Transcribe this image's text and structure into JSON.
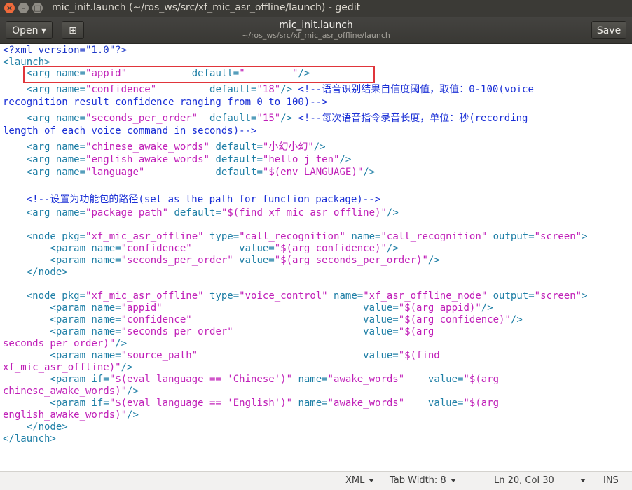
{
  "window": {
    "title": "mic_init.launch (~/ros_ws/src/xf_mic_asr_offline/launch) - gedit",
    "close": "×",
    "minimize": "–",
    "maximize": "□"
  },
  "toolbar": {
    "open_label": "Open ▾",
    "save_label": "Save",
    "doc_title": "mic_init.launch",
    "doc_path": "~/ros_ws/src/xf_mic_asr_offline/launch",
    "new_tab_icon": "⊞"
  },
  "code": {
    "l1": "<?xml version=\"1.0\"?>",
    "l2": "<launch>",
    "l3a": "    <arg name=",
    "l3b": "\"appid\"",
    "l3c": "           default=",
    "l3d": "\"        \"",
    "l3e": "/>",
    "l4a": "    <arg name=",
    "l4b": "\"confidence\"",
    "l4c": "         default=",
    "l4d": "\"18\"",
    "l4e": "/> ",
    "l4f": "<!--语音识别结果自信度阈值，取值：0-100(voice",
    "l5": "recognition result confidence ranging from 0 to 100)-->",
    "l6a": "    <arg name=",
    "l6b": "\"seconds_per_order\"",
    "l6c": "  default=",
    "l6d": "\"15\"",
    "l6e": "/> ",
    "l6f": "<!--每次语音指令录音长度，单位：秒(recording",
    "l7": "length of each voice command in seconds)-->",
    "l8a": "    <arg name=",
    "l8b": "\"chinese_awake_words\"",
    "l8c": " default=",
    "l8d": "\"小幻小幻\"",
    "l8e": "/>",
    "l9a": "    <arg name=",
    "l9b": "\"english_awake_words\"",
    "l9c": " default=",
    "l9d": "\"hello j ten\"",
    "l9e": "/>",
    "l10a": "    <arg name=",
    "l10b": "\"language\"",
    "l10c": "            default=",
    "l10d": "\"$(env LANGUAGE)\"",
    "l10e": "/>",
    "l12": "    <!--设置为功能包的路径(set as the path for function package)-->",
    "l13a": "    <arg name=",
    "l13b": "\"package_path\"",
    "l13c": " default=",
    "l13d": "\"$(find xf_mic_asr_offline)\"",
    "l13e": "/>",
    "l15a": "    <node pkg=",
    "l15b": "\"xf_mic_asr_offline\"",
    "l15c": " type=",
    "l15d": "\"call_recognition\"",
    "l15e": " name=",
    "l15f": "\"call_recognition\"",
    "l15g": " output=",
    "l15h": "\"screen\"",
    "l15i": ">",
    "l16a": "        <param name=",
    "l16b": "\"confidence\"",
    "l16c": "        value=",
    "l16d": "\"$(arg confidence)\"",
    "l16e": "/>",
    "l17a": "        <param name=",
    "l17b": "\"seconds_per_order\"",
    "l17c": " value=",
    "l17d": "\"$(arg seconds_per_order)\"",
    "l17e": "/>",
    "l18": "    </node>",
    "l20a": "    <node pkg=",
    "l20b": "\"xf_mic_asr_offline\"",
    "l20c": " type=",
    "l20d": "\"voice_control\"",
    "l20e": " name=",
    "l20f": "\"xf_asr_offline_node\"",
    "l20g": " output=",
    "l20h": "\"screen\"",
    "l20i": ">",
    "l21a": "        <param name=",
    "l21b": "\"appid\"",
    "l21c": "                                  value=",
    "l21d": "\"$(arg appid)\"",
    "l21e": "/>",
    "l22a": "        <param name=",
    "l22b": "\"confidence\"",
    "l22c": "                             value=",
    "l22d": "\"$(arg confidence)\"",
    "l22e": "/>",
    "l23a": "        <param name=",
    "l23b": "\"seconds_per_order\"",
    "l23c": "                      value=",
    "l23d": "\"$(arg",
    "l24a": "seconds_per_order)\"",
    "l24b": "/>",
    "l25a": "        <param name=",
    "l25b": "\"source_path\"",
    "l25c": "                            value=",
    "l25d": "\"$(find",
    "l26a": "xf_mic_asr_offline)\"",
    "l26b": "/>",
    "l27a": "        <param if=",
    "l27b": "\"$(eval language == 'Chinese')\"",
    "l27c": " name=",
    "l27d": "\"awake_words\"",
    "l27e": "    value=",
    "l27f": "\"$(arg",
    "l28a": "chinese_awake_words)\"",
    "l28b": "/>",
    "l29a": "        <param if=",
    "l29b": "\"$(eval language == 'English')\"",
    "l29c": " name=",
    "l29d": "\"awake_words\"",
    "l29e": "    value=",
    "l29f": "\"$(arg",
    "l30a": "english_awake_words)\"",
    "l30b": "/>",
    "l31": "    </node>",
    "l32": "</launch>"
  },
  "statusbar": {
    "language": "XML",
    "tab_width": "Tab Width: 8",
    "position": "Ln 20, Col 30",
    "mode": "INS"
  }
}
